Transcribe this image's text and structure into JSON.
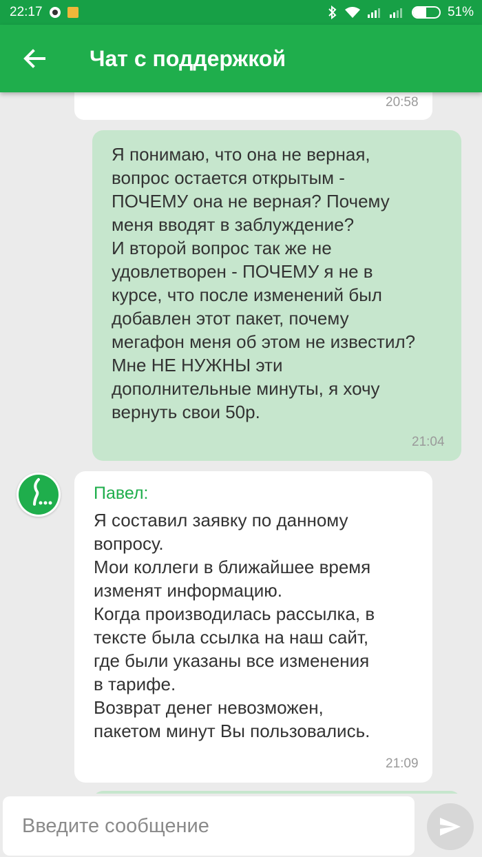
{
  "status_bar": {
    "time": "22:17",
    "battery_percent": "51%",
    "battery_level": 0.51,
    "icons": [
      "notification-icon",
      "notification-flag-icon",
      "bluetooth-icon",
      "wifi-icon",
      "signal-icon",
      "signal-icon-2",
      "battery-icon"
    ]
  },
  "app_bar": {
    "title": "Чат с поддержкой",
    "back_icon": "arrow-left-icon",
    "color": "#1fae4c"
  },
  "messages": [
    {
      "direction": "incoming",
      "time": "20:58"
    },
    {
      "direction": "outgoing",
      "text": "Я понимаю, что она не верная,\nвопрос остается открытым -\nПОЧЕМУ она не верная? Почему\nменя вводят в заблуждение?\nИ второй вопрос так же не\nудовлетворен - ПОЧЕМУ я не в\nкурсе, что после изменений был\nдобавлен этот пакет, почему\nмегафон меня об этом не известил?\nМне НЕ НУЖНЫ эти\nдополнительные минуты, я хочу\nвернуть свои 50р.",
      "time": "21:04"
    },
    {
      "direction": "incoming",
      "author": "Павел:",
      "text": "Я составил заявку по данному\nвопросу.\nМои коллеги в ближайшее время\nизменят информацию.\nКогда производилась рассылка, в\nтексте была ссылка на наш сайт,\nгде были указаны все изменения\nв тарифе.\nВозврат денег невозможен,\nпакетом минут Вы пользовались.",
      "time": "21:09"
    }
  ],
  "composer": {
    "placeholder": "Введите сообщение",
    "send_icon": "send-icon"
  },
  "colors": {
    "accent": "#1fae4c",
    "outgoing_bubble": "#c6e6cd",
    "incoming_bubble": "#ffffff",
    "background": "#ebebeb"
  }
}
